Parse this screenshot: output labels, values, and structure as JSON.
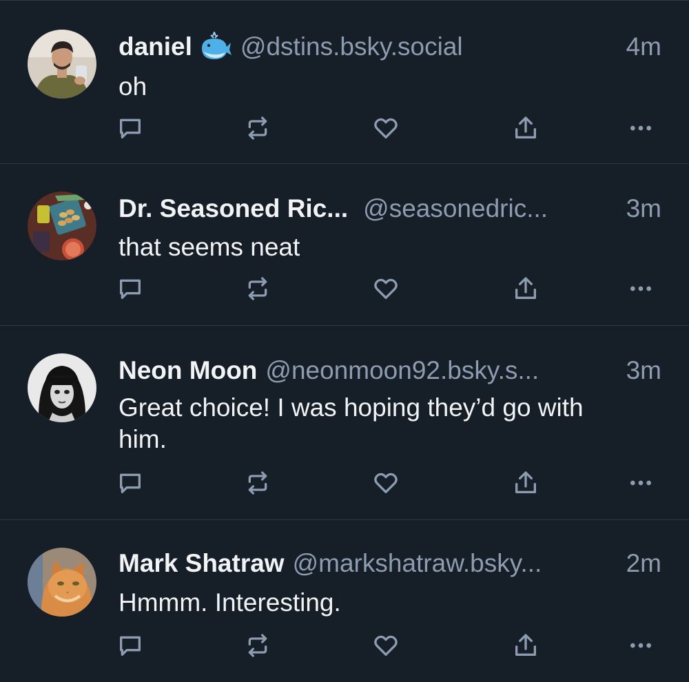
{
  "theme": {
    "background": "#161e27",
    "divider": "#2c3a4a",
    "text_primary": "#f1f3f5",
    "text_secondary": "#8d9cb0",
    "icon": "#8d9cb0"
  },
  "posts": [
    {
      "name": "daniel",
      "has_badge": true,
      "badge_icon": "whale-icon",
      "handle": "@dstins.bsky.social",
      "time": "4m",
      "text": "oh",
      "avatar": "man-selfie-avatar"
    },
    {
      "name": "Dr. Seasoned Ric...",
      "has_badge": false,
      "handle": "@seasonedric...",
      "time": "3m",
      "text": "that seems neat",
      "avatar": "food-platter-avatar"
    },
    {
      "name": "Neon Moon",
      "has_badge": false,
      "handle": "@neonmoon92.bsky.s...",
      "time": "3m",
      "text": "Great choice! I was hoping they’d go with him.",
      "avatar": "anime-girl-avatar"
    },
    {
      "name": "Mark Shatraw",
      "has_badge": false,
      "handle": "@markshatraw.bsky...",
      "time": "2m",
      "text": "Hmmm. Interesting.",
      "avatar": "orange-cat-avatar"
    }
  ],
  "action_icons": [
    "reply-icon",
    "repost-icon",
    "like-icon",
    "share-icon",
    "more-icon"
  ]
}
